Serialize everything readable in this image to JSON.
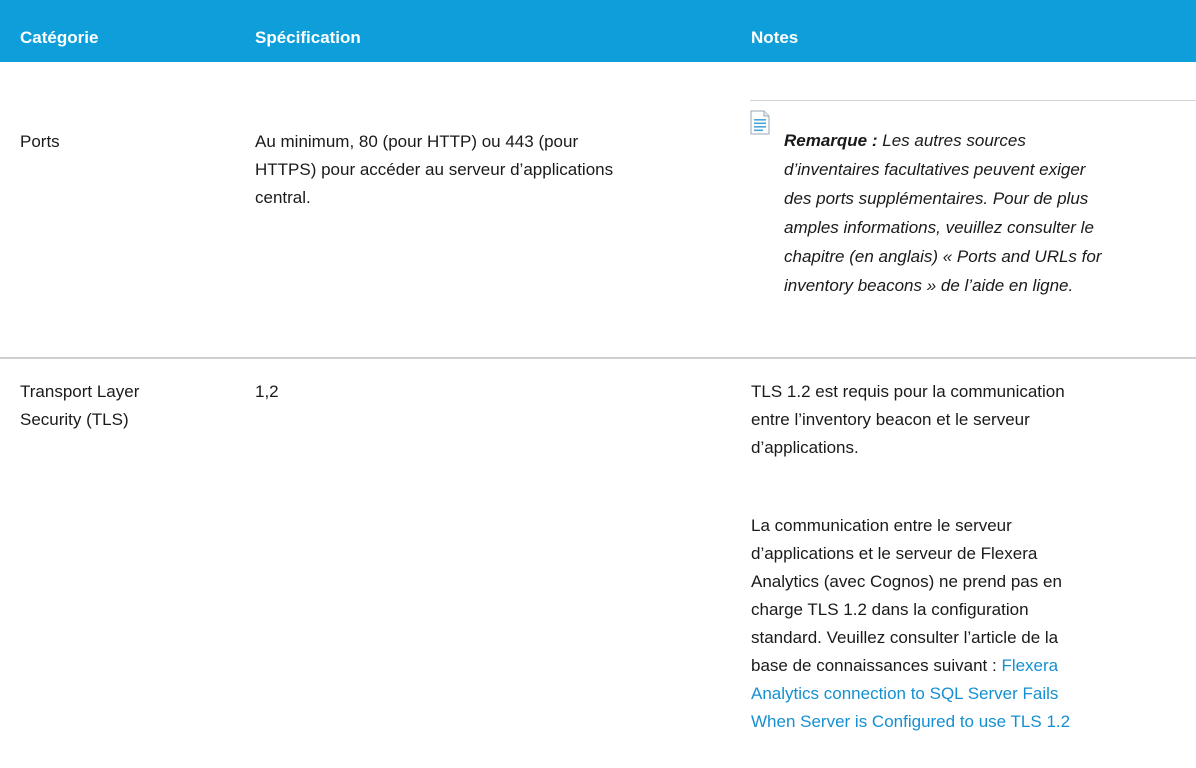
{
  "header": {
    "col1": "Catégorie",
    "col2": "Spécification",
    "col3": "Notes"
  },
  "rows": [
    {
      "category": "Ports",
      "spec_lines": [
        "Au minimum, 80 (pour HTTP) ou 443 (pour",
        "HTTPS) pour accéder au serveur d’applications",
        "central."
      ],
      "note_label": "Remarque :",
      "note_first": " Les autres sources",
      "note_lines": [
        "d’inventaires facultatives peuvent exiger",
        "des ports supplémentaires. Pour de plus",
        "amples informations, veuillez consulter le",
        "chapitre (en anglais) « Ports and URLs for",
        "inventory beacons » de l’aide en ligne."
      ]
    },
    {
      "category_lines": [
        "Transport Layer",
        "Security (TLS)"
      ],
      "spec": "1,2",
      "notes_p1_lines": [
        "TLS 1.2 est requis pour la communication",
        "entre l’inventory beacon et le serveur",
        "d’applications."
      ],
      "notes_p2_lines": [
        "La communication entre le serveur",
        "d’applications et le serveur de Flexera",
        "Analytics (avec Cognos) ne prend pas en",
        "charge TLS 1.2 dans la configuration",
        "standard. Veuillez consulter l’article de la"
      ],
      "notes_p2_last_prefix": "base de connaissances suivant : ",
      "link_lines": [
        "Flexera",
        "Analytics connection to SQL Server Fails",
        "When Server is Configured to use TLS 1.2"
      ]
    }
  ],
  "colors": {
    "header_bg": "#0e9ed9",
    "link": "#1490d2",
    "divider": "#cfcfcf"
  },
  "icons": {
    "note": "note-icon"
  }
}
